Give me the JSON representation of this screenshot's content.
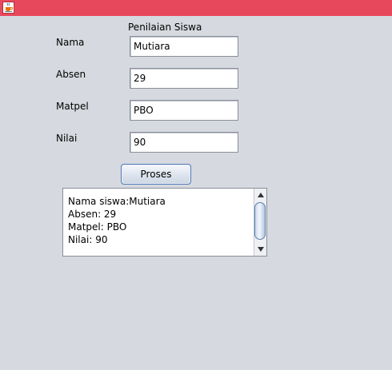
{
  "window": {
    "title_bar_color": "#e8485c",
    "icon": "java-cup-icon"
  },
  "form": {
    "title": "Penilaian Siswa",
    "fields": [
      {
        "label": "Nama",
        "value": "Mutiara"
      },
      {
        "label": "Absen",
        "value": "29"
      },
      {
        "label": "Matpel",
        "value": "PBO"
      },
      {
        "label": "Nilai",
        "value": "90"
      }
    ],
    "button_label": "Proses"
  },
  "output": {
    "lines": [
      "Nama siswa:Mutiara",
      "Absen: 29",
      "Matpel: PBO",
      "Nilai: 90"
    ]
  }
}
